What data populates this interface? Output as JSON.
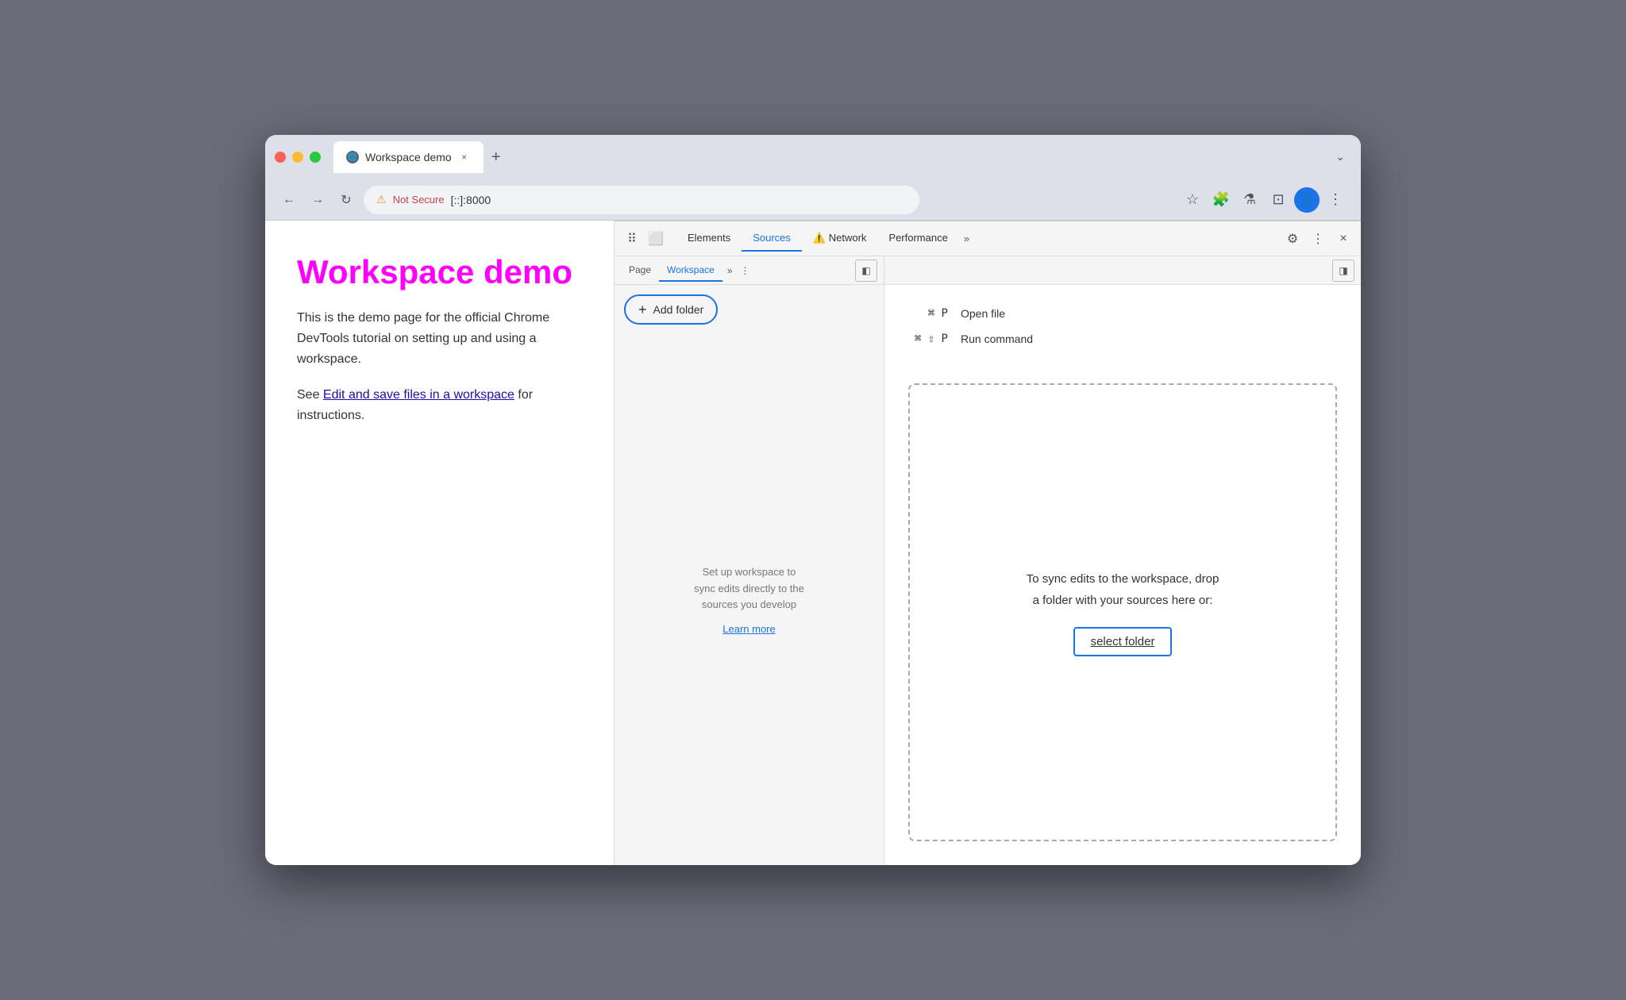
{
  "browser": {
    "tab": {
      "title": "Workspace demo",
      "favicon": "🌐",
      "close_label": "×",
      "new_tab_label": "+"
    },
    "chevron_down": "⌄",
    "nav": {
      "back": "←",
      "forward": "→",
      "refresh": "↻"
    },
    "address_bar": {
      "security_icon": "⚠",
      "not_secure": "Not Secure",
      "url": "[::]:8000"
    },
    "toolbar_icons": {
      "bookmark": "☆",
      "extensions": "🧩",
      "lab": "⚗",
      "split": "⊡",
      "profile": "👤",
      "more": "⋮"
    }
  },
  "webpage": {
    "title": "Workspace demo",
    "body1": "This is the demo page for the official Chrome DevTools tutorial on setting up and using a workspace.",
    "body2_prefix": "See ",
    "link_text": "Edit and save files in a workspace",
    "body2_suffix": " for instructions."
  },
  "devtools": {
    "toolbar": {
      "inspect_icon": "⠿",
      "device_icon": "⬜"
    },
    "tabs": [
      {
        "label": "Elements",
        "active": false
      },
      {
        "label": "Sources",
        "active": true
      },
      {
        "label": "Network",
        "active": false,
        "warning": true
      },
      {
        "label": "Performance",
        "active": false
      }
    ],
    "more_tabs": "»",
    "right_icons": {
      "settings": "⚙",
      "more": "⋮",
      "close": "×"
    },
    "sources": {
      "left_tabs": [
        {
          "label": "Page",
          "active": false
        },
        {
          "label": "Workspace",
          "active": true
        }
      ],
      "more": "»",
      "menu": "⋮",
      "panel_toggle": "◧",
      "panel_toggle_right": "◨",
      "add_folder": {
        "plus": "+",
        "label": "Add folder"
      },
      "empty_state": {
        "line1": "Set up workspace to",
        "line2": "sync edits directly to the",
        "line3": "sources you develop",
        "learn_more": "Learn more"
      },
      "drop_zone": {
        "line1": "To sync edits to the workspace, drop",
        "line2": "a folder with your sources here or:",
        "select_folder": "select folder"
      },
      "shortcuts": [
        {
          "key": "⌘ P",
          "action": "Open file"
        },
        {
          "key": "⌘ ⇧ P",
          "action": "Run command"
        }
      ]
    }
  }
}
